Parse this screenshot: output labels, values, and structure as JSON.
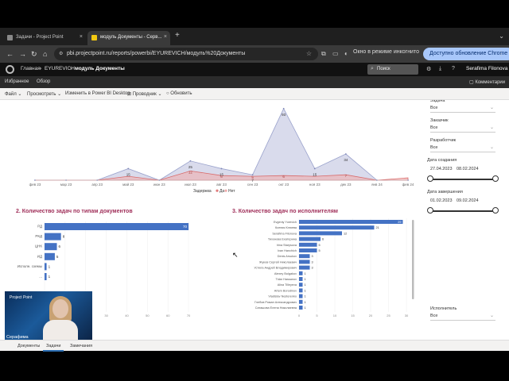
{
  "browser": {
    "tabs": [
      {
        "title": "Задачи - Project Point"
      },
      {
        "title": "модуль Документы - Серв..."
      }
    ],
    "url": "pbi.projectpoint.ru/reports/powerbi/EYUREVICH/модуль%20Документы",
    "incognito": "Окно в режиме инкогнито",
    "update_button": "Доступно обновление Chrome"
  },
  "pbi": {
    "breadcrumbs": [
      "Главная",
      "EYUREVICH",
      "модуль Документы"
    ],
    "search_placeholder": "Поиск",
    "user": "Serafima Filonova",
    "app_bar": {
      "favorites": "Избранное",
      "overview": "Обзор",
      "comments": "Комментарии"
    },
    "toolbar": {
      "file": "Файл",
      "view": "Просмотреть",
      "edit": "Изменить в Power BI Desktop",
      "explorer": "Проводник",
      "refresh": "Обновить"
    }
  },
  "slicers": [
    {
      "label": "Задача",
      "value": "Все"
    },
    {
      "label": "Заказчик",
      "value": "Все"
    },
    {
      "label": "Разработчик",
      "value": "Все"
    },
    {
      "label": "Исполнитель",
      "value": "Все"
    }
  ],
  "date_slicers": [
    {
      "label": "Дата создания",
      "from": "27.04.2023",
      "to": "08.02.2024"
    },
    {
      "label": "Дата завершения",
      "from": "01.02.2023",
      "to": "09.02.2024"
    }
  ],
  "chart_data": [
    {
      "type": "area",
      "categories": [
        "фев 23",
        "мар 23",
        "апр 23",
        "май 23",
        "июн 23",
        "июл 23",
        "авг 23",
        "сен 23",
        "окт 23",
        "ноя 23",
        "дек 23",
        "янв 24",
        "фев 24"
      ],
      "series": [
        {
          "name": "",
          "values": [
            0,
            0,
            0,
            15,
            0,
            25,
            15,
            7,
            93,
            15,
            34,
            0,
            0
          ],
          "color": "#b9bedd"
        },
        {
          "name": "Да",
          "values": [
            0,
            0,
            0,
            0,
            0,
            0,
            0,
            0,
            0,
            0,
            0,
            0,
            0
          ],
          "color": "#e07b7b"
        },
        {
          "name": "Нет",
          "values": [
            0,
            0,
            0,
            5,
            0,
            12,
            6,
            5,
            6,
            5,
            7,
            0,
            3
          ],
          "color": "#f0a9a9"
        }
      ],
      "data_labels": [
        {
          "i": 3,
          "v": "15"
        },
        {
          "i": 5,
          "v": "25"
        },
        {
          "i": 6,
          "v": "15"
        },
        {
          "i": 7,
          "v": "7"
        },
        {
          "i": 8,
          "v": "93"
        },
        {
          "i": 9,
          "v": "15"
        },
        {
          "i": 10,
          "v": "34"
        }
      ],
      "red_labels": [
        {
          "i": 5,
          "v": "12"
        },
        {
          "i": 6,
          "v": "6"
        },
        {
          "i": 7,
          "v": "5"
        },
        {
          "i": 8,
          "v": "6"
        },
        {
          "i": 10,
          "v": "7"
        }
      ],
      "legend_title": "Задержка",
      "legend": [
        "Да",
        "Нет"
      ],
      "ylim": [
        0,
        100
      ]
    },
    {
      "type": "bar",
      "title": "2. Количество задач по типам документов",
      "categories": [
        "РД",
        "РКД",
        "ЦНК",
        "ИД",
        "Исполн. схемы",
        "..."
      ],
      "values": [
        70,
        8,
        6,
        5,
        1,
        1
      ],
      "value_labels": [
        "70",
        "8",
        "6",
        "5",
        "1",
        "1"
      ],
      "ticks": [
        "0",
        "10",
        "20",
        "30",
        "40",
        "50",
        "60",
        "70"
      ],
      "xlim": [
        0,
        75
      ],
      "color": "#4472c4"
    },
    {
      "type": "bar",
      "title": "3. Количество задач по исполнителям",
      "categories": [
        "Evgeniy Yurevich",
        "Ксения Клюева",
        "Serafima Filonova",
        "Тихонова Екатерина",
        "Irina Starysova",
        "Ivan Hanchich",
        "Denis Arsukov",
        "Жуков Сергей Николаевич",
        "Устюга Андрей Владимирович",
        "Alexey Bulgakov",
        "Tidar Hassanov",
        "Alina Tilleyeva",
        "Artem Borodinov",
        "Vladislav Nesterenko",
        "Глебов Роман Александрович",
        "Саташова Елена Николаевна"
      ],
      "values": [
        29,
        21,
        12,
        6,
        5,
        5,
        3,
        3,
        3,
        1,
        1,
        1,
        1,
        1,
        1,
        1
      ],
      "ticks": [
        "0",
        "5",
        "10",
        "15",
        "20",
        "25",
        "30"
      ],
      "xlim": [
        0,
        30
      ],
      "color": "#4472c4"
    }
  ],
  "webcam": {
    "logo": "Project Point",
    "name": "Серафима"
  },
  "pages": [
    "Документы",
    "Задачи",
    "Замечания"
  ]
}
